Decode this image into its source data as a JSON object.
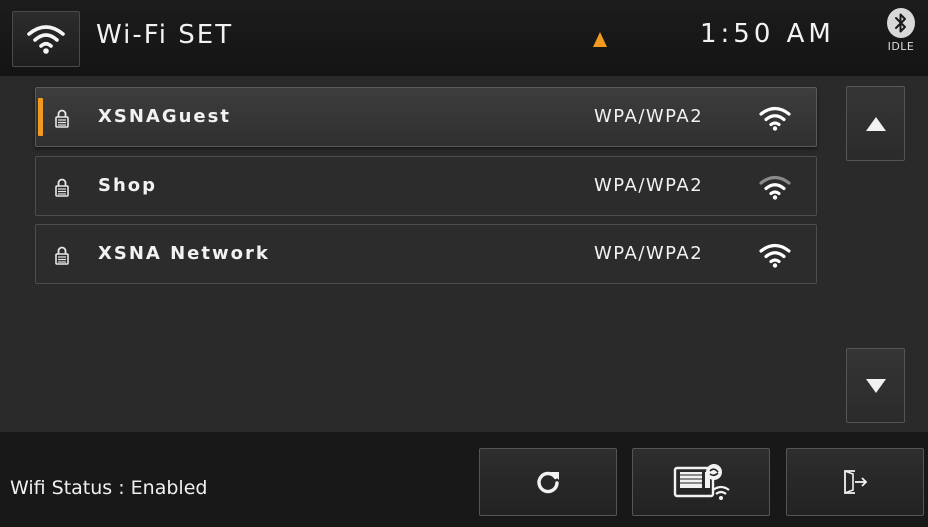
{
  "header": {
    "wifi_icon": "wifi-icon",
    "title": "Wi-Fi SET",
    "nav_indicator_icon": "navigation-arrow-icon",
    "nav_indicator_color": "#f29a1f",
    "time": "1:50 AM",
    "bluetooth_icon": "bluetooth-icon",
    "bluetooth_status": "IDLE"
  },
  "networks": [
    {
      "ssid": "XSNAGuest",
      "security": "WPA/WPA2",
      "selected": true,
      "locked": true,
      "signal": "strong"
    },
    {
      "ssid": "Shop",
      "security": "WPA/WPA2",
      "selected": false,
      "locked": true,
      "signal": "medium"
    },
    {
      "ssid": "XSNA Network",
      "security": "WPA/WPA2",
      "selected": false,
      "locked": true,
      "signal": "strong"
    }
  ],
  "scroll": {
    "up_icon": "scroll-up-icon",
    "down_icon": "scroll-down-icon"
  },
  "footer": {
    "status_text": "Wifi Status : Enabled",
    "refresh_icon": "refresh-icon",
    "device_wifi_icon": "device-wifi-settings-icon",
    "exit_icon": "exit-icon"
  },
  "colors": {
    "accent": "#f29a1f",
    "background": "#2a2a2a",
    "header": "#161616",
    "footer": "#181818"
  }
}
